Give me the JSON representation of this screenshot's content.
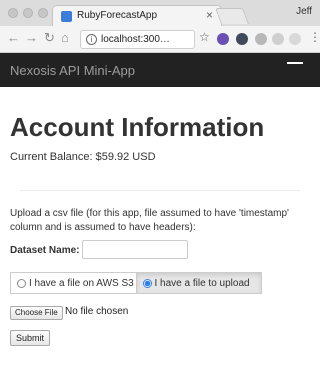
{
  "browser": {
    "tab_title": "RubyForecastApp",
    "tab_close": "×",
    "user_name": "Jeff",
    "url": "localhost:300…",
    "info_icon": "i"
  },
  "navbar": {
    "brand": "Nexosis API Mini-App"
  },
  "page": {
    "title": "Account Information",
    "balance": "Current Balance: $59.92 USD",
    "instructions": "Upload a csv file (for this app, file assumed to have 'timestamp' column and is assumed to have headers):"
  },
  "form": {
    "dataset_label": "Dataset Name:",
    "dataset_value": "",
    "option_s3": "I have a file on AWS S3",
    "option_upload": "I have a file to upload",
    "selected_option": "upload",
    "choose_file_label": "Choose File",
    "no_file_text": "No file chosen",
    "submit_label": "Submit"
  },
  "colors": {
    "navbar_bg": "#222222",
    "navbar_text": "#9d9d9d",
    "radio_accent": "#2f7fe8"
  }
}
